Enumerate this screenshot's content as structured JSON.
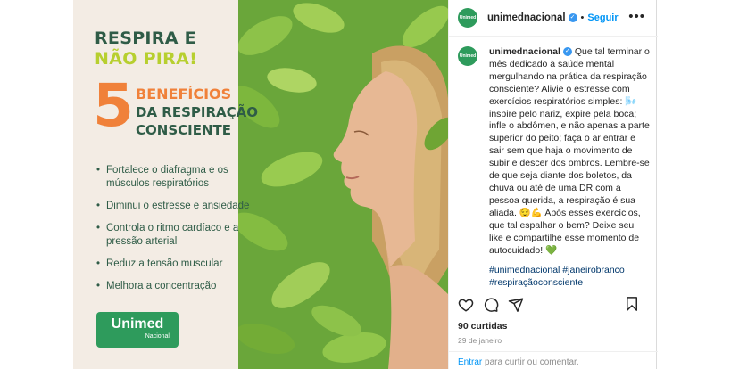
{
  "post": {
    "headline_line1": "RESPIRA E",
    "headline_line2": "NÃO PIRA!",
    "number": "5",
    "subhead_line1": "BENEFÍCIOS",
    "subhead_line2": "DA RESPIRAÇÃO",
    "subhead_line3": "CONSCIENTE",
    "benefits": [
      "Fortalece o diafragma e os músculos respiratórios",
      "Diminui o estresse e ansiedade",
      "Controla o ritmo cardíaco e a pressão arterial",
      "Reduz a tensão muscular",
      "Melhora a concentração"
    ],
    "logo_brand": "Unimed",
    "logo_sub": "Nacional"
  },
  "header": {
    "avatar_text": "Unimed",
    "username": "unimednacional",
    "separator": "•",
    "follow_label": "Seguir",
    "more_icon": "more-horizontal-icon"
  },
  "caption": {
    "username": "unimednacional",
    "text": " Que tal terminar o mês dedicado à saúde mental mergulhando na prática da respiração consciente? Alivie o estresse com exercícios respiratórios simples: 🌬️ inspire pelo nariz, expire pela boca; infle o abdômen, e não apenas a parte superior do peito; faça o ar entrar e sair sem que haja o movimento de subir e descer dos ombros. Lembre-se de que seja diante dos boletos, da chuva ou até de uma DR com a pessoa querida, a respiração é sua aliada. 😌💪 Após esses exercícios, que tal espalhar o bem? Deixe seu like e compartilhe esse momento de autocuidado! 💚",
    "hashtags": "#unimednacional #janeirobranco #respiraçãoconsciente"
  },
  "actions": {
    "icons": [
      "heart-icon",
      "comment-icon",
      "share-icon",
      "bookmark-icon"
    ]
  },
  "likes": "90 curtidas",
  "date": "29 de janeiro",
  "login_prompt": {
    "link": "Entrar",
    "text": " para curtir ou comentar."
  },
  "colors": {
    "brand_green": "#2e9b5c",
    "dark_green": "#2f5c47",
    "lime": "#b7cf2f",
    "orange": "#f0813a",
    "link_blue": "#0095f6",
    "hashtag_blue": "#00376b"
  }
}
